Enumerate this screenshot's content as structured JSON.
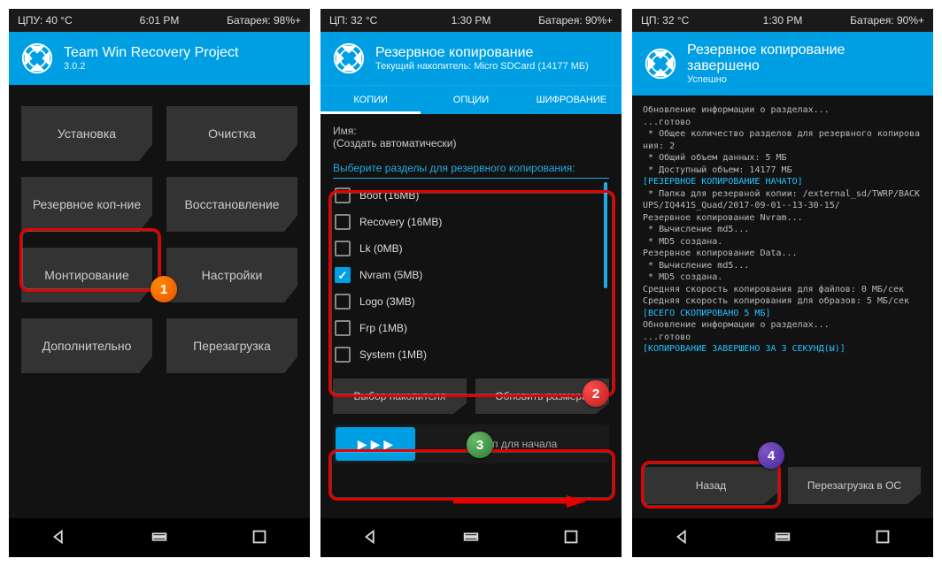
{
  "screens": [
    {
      "status": {
        "left": "ЦПУ: 40 °C",
        "center": "6:01 PM",
        "right": "Батарея: 98%+"
      },
      "header": {
        "title": "Team Win Recovery Project",
        "sub": "3.0.2"
      },
      "buttons": [
        "Установка",
        "Очистка",
        "Резервное коп-ние",
        "Восстановление",
        "Монтирование",
        "Настройки",
        "Дополнительно",
        "Перезагрузка"
      ]
    },
    {
      "status": {
        "left": "ЦП: 32 °C",
        "center": "1:30 PM",
        "right": "Батарея: 90%+"
      },
      "header": {
        "title": "Резервное копирование",
        "sub": "Текущий накопитель: Micro SDCard (14177 МБ)"
      },
      "tabs": [
        "КОПИИ",
        "ОПЦИИ",
        "ШИФРОВАНИЕ"
      ],
      "name_label": "Имя:",
      "name_value": "(Создать автоматически)",
      "section_title": "Выберите разделы для резервного копирования:",
      "partitions": [
        {
          "label": "Boot (16MB)",
          "checked": false
        },
        {
          "label": "Recovery (16MB)",
          "checked": false
        },
        {
          "label": "Lk (0MB)",
          "checked": false
        },
        {
          "label": "Nvram (5MB)",
          "checked": true
        },
        {
          "label": "Logo (3MB)",
          "checked": false
        },
        {
          "label": "Frp (1MB)",
          "checked": false
        },
        {
          "label": "System (1MB)",
          "checked": false
        }
      ],
      "btn_storage": "Выбор накопителя",
      "btn_refresh": "Обновить размеры",
      "swipe_label": "Свайп для начала"
    },
    {
      "status": {
        "left": "ЦП: 32 °C",
        "center": "1:30 PM",
        "right": "Батарея: 90%+"
      },
      "header": {
        "title": "Резервное копирование завершено",
        "sub": "Успешно"
      },
      "console": [
        {
          "t": "Обновление информации о разделах...",
          "cl": ""
        },
        {
          "t": "...готово",
          "cl": ""
        },
        {
          "t": " * Общее количество разделов для резервного копирования: 2",
          "cl": ""
        },
        {
          "t": " * Общий объем данных: 5 МБ",
          "cl": ""
        },
        {
          "t": " * Доступный объем: 14177 МБ",
          "cl": ""
        },
        {
          "t": "[РЕЗЕРВНОЕ КОПИРОВАНИЕ НАЧАТО]",
          "cl": "cyan"
        },
        {
          "t": " * Папка для резервной копии: /external_sd/TWRP/BACKUPS/IQ441S_Quad/2017-09-01--13-30-15/",
          "cl": ""
        },
        {
          "t": "Резервное копирование Nvram...",
          "cl": ""
        },
        {
          "t": " * Вычисление md5...",
          "cl": ""
        },
        {
          "t": " * MD5 создана.",
          "cl": ""
        },
        {
          "t": "Резервное копирование Data...",
          "cl": ""
        },
        {
          "t": " * Вычисление md5...",
          "cl": ""
        },
        {
          "t": " * MD5 создана.",
          "cl": ""
        },
        {
          "t": "Средняя скорость копирования для файлов: 0 МБ/сек",
          "cl": ""
        },
        {
          "t": "Средняя скорость копирования для образов: 5 МБ/сек",
          "cl": ""
        },
        {
          "t": "[ВСЕГО СКОПИРОВАНО 5 МБ]",
          "cl": "cyan"
        },
        {
          "t": "Обновление информации о разделах...",
          "cl": ""
        },
        {
          "t": "...готово",
          "cl": ""
        },
        {
          "t": "[КОПИРОВАНИЕ ЗАВЕРШЕНО ЗА 3 СЕКУНД(Ы)]",
          "cl": "cyan"
        }
      ],
      "btn_back": "Назад",
      "btn_reboot": "Перезагрузка в ОС"
    }
  ],
  "badges": [
    "1",
    "2",
    "3",
    "4"
  ]
}
